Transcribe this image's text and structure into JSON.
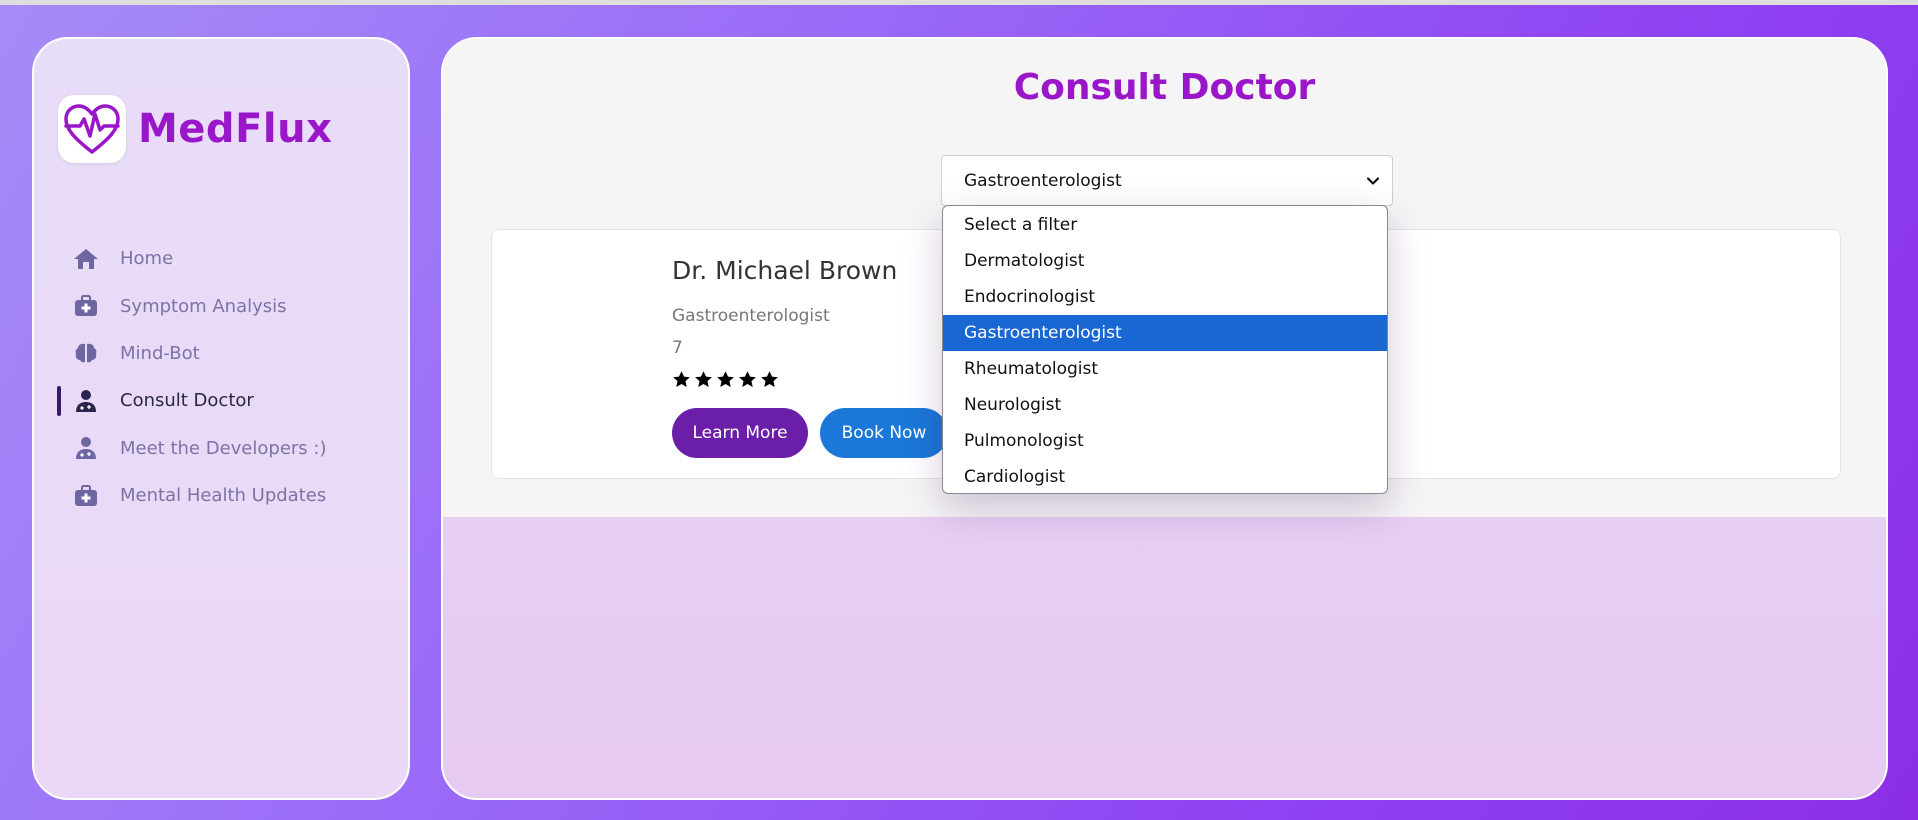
{
  "brand": {
    "name": "MedFlux"
  },
  "nav": {
    "items": [
      {
        "label": "Home",
        "icon": "home-icon",
        "active": false
      },
      {
        "label": "Symptom Analysis",
        "icon": "medical-kit-icon",
        "active": false
      },
      {
        "label": "Mind-Bot",
        "icon": "brain-icon",
        "active": false
      },
      {
        "label": "Consult Doctor",
        "icon": "doctor-icon",
        "active": true
      },
      {
        "label": "Meet the Developers :)",
        "icon": "doctor-icon",
        "active": false
      },
      {
        "label": "Mental Health Updates",
        "icon": "medical-kit-icon",
        "active": false
      }
    ]
  },
  "page": {
    "title": "Consult Doctor"
  },
  "filter": {
    "selected": "Gastroenterologist",
    "options": [
      "Select a filter",
      "Dermatologist",
      "Endocrinologist",
      "Gastroenterologist",
      "Rheumatologist",
      "Neurologist",
      "Pulmonologist",
      "Cardiologist"
    ]
  },
  "doctor": {
    "name": "Dr. Michael Brown",
    "specialty": "Gastroenterologist",
    "experience": "7",
    "rating": 5,
    "learn_label": "Learn More",
    "book_label": "Book Now"
  },
  "colors": {
    "brand": "#9a16c9",
    "learn_button": "#6b1fa8",
    "book_button": "#1b78d8",
    "selected_option": "#1967d2"
  }
}
